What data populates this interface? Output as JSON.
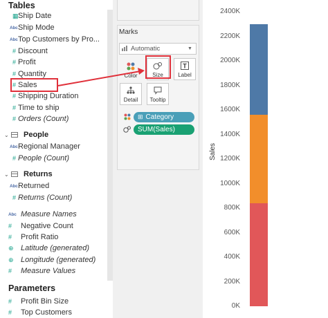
{
  "data_pane": {
    "tables_title": "Tables",
    "orders_fields": [
      {
        "icon": "date",
        "label": "Ship Date",
        "italic": false
      },
      {
        "icon": "abc",
        "label": "Ship Mode",
        "italic": false
      },
      {
        "icon": "abc",
        "label": "Top Customers by Pro...",
        "italic": false
      },
      {
        "icon": "hash",
        "label": "Discount",
        "italic": false
      },
      {
        "icon": "hash",
        "label": "Profit",
        "italic": false
      },
      {
        "icon": "hash",
        "label": "Quantity",
        "italic": false
      },
      {
        "icon": "hash",
        "label": "Sales",
        "italic": false
      },
      {
        "icon": "hash-date",
        "label": "Shipping Duration",
        "italic": false
      },
      {
        "icon": "hash-date",
        "label": "Time to ship",
        "italic": false
      },
      {
        "icon": "hash",
        "label": "Orders (Count)",
        "italic": true
      }
    ],
    "people_group": {
      "label": "People",
      "fields": [
        {
          "icon": "abc",
          "label": "Regional Manager",
          "italic": false
        },
        {
          "icon": "hash",
          "label": "People (Count)",
          "italic": true
        }
      ]
    },
    "returns_group": {
      "label": "Returns",
      "fields": [
        {
          "icon": "abc",
          "label": "Returned",
          "italic": false
        },
        {
          "icon": "hash",
          "label": "Returns (Count)",
          "italic": true
        }
      ]
    },
    "measure_fields": [
      {
        "icon": "abc",
        "label": "Measure Names",
        "italic": true
      },
      {
        "icon": "hash",
        "label": "Negative Count",
        "italic": false
      },
      {
        "icon": "hash",
        "label": "Profit Ratio",
        "italic": false
      },
      {
        "icon": "geo",
        "label": "Latitude (generated)",
        "italic": true
      },
      {
        "icon": "geo",
        "label": "Longitude (generated)",
        "italic": true
      },
      {
        "icon": "hash",
        "label": "Measure Values",
        "italic": true
      }
    ],
    "parameters_title": "Parameters",
    "parameters": [
      {
        "icon": "hash",
        "label": "Profit Bin Size"
      },
      {
        "icon": "hash",
        "label": "Top Customers"
      }
    ]
  },
  "marks_card": {
    "title": "Marks",
    "mark_type": "Automatic",
    "buttons": {
      "color": "Color",
      "size": "Size",
      "label": "Label",
      "detail": "Detail",
      "tooltip": "Tooltip"
    },
    "pills": [
      {
        "label": "Category",
        "color": "#4a9fb8",
        "icon": "color-dots-icon",
        "prefix": "⊞"
      },
      {
        "label": "SUM(Sales)",
        "color": "#1aa173",
        "icon": "size-icon",
        "prefix": ""
      }
    ]
  },
  "chart_data": {
    "type": "bar",
    "ylabel": "Sales",
    "ylim": [
      0,
      2400000
    ],
    "yticks": [
      "2400K",
      "2200K",
      "2000K",
      "1800K",
      "1600K",
      "1400K",
      "1200K",
      "1000K",
      "800K",
      "600K",
      "400K",
      "200K",
      "0K"
    ],
    "series": [
      {
        "category_color": "#e15759",
        "value": 840000
      },
      {
        "category_color": "#f28e2b",
        "value": 720000
      },
      {
        "category_color": "#4e79a7",
        "value": 740000
      }
    ],
    "total": 2300000
  },
  "colors": {
    "annotation_red": "#e0303a",
    "measure_green": "#1aa28b",
    "dimension_blue": "#4f6ea8"
  }
}
